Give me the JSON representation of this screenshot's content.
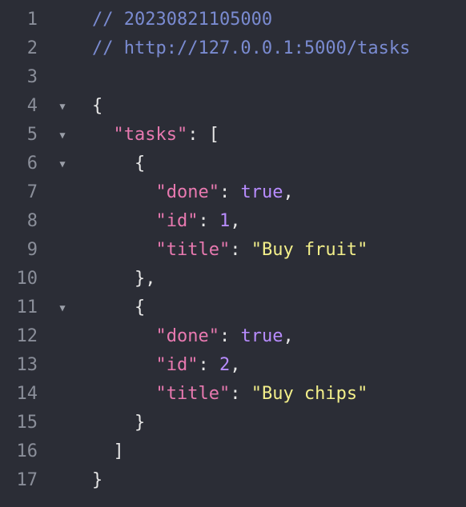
{
  "editor": {
    "lines": [
      {
        "n": "1",
        "fold": false,
        "tokens": [
          {
            "t": "// 20230821105000",
            "c": "comment"
          }
        ]
      },
      {
        "n": "2",
        "fold": false,
        "tokens": [
          {
            "t": "// http://127.0.0.1:5000/tasks",
            "c": "comment"
          }
        ]
      },
      {
        "n": "3",
        "fold": false,
        "tokens": []
      },
      {
        "n": "4",
        "fold": true,
        "tokens": [
          {
            "t": "{",
            "c": "punc"
          }
        ]
      },
      {
        "n": "5",
        "fold": true,
        "tokens": [
          {
            "t": "  ",
            "c": "punc"
          },
          {
            "t": "\"tasks\"",
            "c": "key"
          },
          {
            "t": ": [",
            "c": "punc"
          }
        ]
      },
      {
        "n": "6",
        "fold": true,
        "tokens": [
          {
            "t": "    {",
            "c": "punc"
          }
        ]
      },
      {
        "n": "7",
        "fold": false,
        "tokens": [
          {
            "t": "      ",
            "c": "punc"
          },
          {
            "t": "\"done\"",
            "c": "key"
          },
          {
            "t": ": ",
            "c": "punc"
          },
          {
            "t": "true",
            "c": "bool"
          },
          {
            "t": ",",
            "c": "punc"
          }
        ]
      },
      {
        "n": "8",
        "fold": false,
        "tokens": [
          {
            "t": "      ",
            "c": "punc"
          },
          {
            "t": "\"id\"",
            "c": "key"
          },
          {
            "t": ": ",
            "c": "punc"
          },
          {
            "t": "1",
            "c": "num"
          },
          {
            "t": ",",
            "c": "punc"
          }
        ]
      },
      {
        "n": "9",
        "fold": false,
        "tokens": [
          {
            "t": "      ",
            "c": "punc"
          },
          {
            "t": "\"title\"",
            "c": "key"
          },
          {
            "t": ": ",
            "c": "punc"
          },
          {
            "t": "\"Buy fruit\"",
            "c": "str"
          }
        ]
      },
      {
        "n": "10",
        "fold": false,
        "tokens": [
          {
            "t": "    },",
            "c": "punc"
          }
        ]
      },
      {
        "n": "11",
        "fold": true,
        "tokens": [
          {
            "t": "    {",
            "c": "punc"
          }
        ]
      },
      {
        "n": "12",
        "fold": false,
        "tokens": [
          {
            "t": "      ",
            "c": "punc"
          },
          {
            "t": "\"done\"",
            "c": "key"
          },
          {
            "t": ": ",
            "c": "punc"
          },
          {
            "t": "true",
            "c": "bool"
          },
          {
            "t": ",",
            "c": "punc"
          }
        ]
      },
      {
        "n": "13",
        "fold": false,
        "tokens": [
          {
            "t": "      ",
            "c": "punc"
          },
          {
            "t": "\"id\"",
            "c": "key"
          },
          {
            "t": ": ",
            "c": "punc"
          },
          {
            "t": "2",
            "c": "num"
          },
          {
            "t": ",",
            "c": "punc"
          }
        ]
      },
      {
        "n": "14",
        "fold": false,
        "tokens": [
          {
            "t": "      ",
            "c": "punc"
          },
          {
            "t": "\"title\"",
            "c": "key"
          },
          {
            "t": ": ",
            "c": "punc"
          },
          {
            "t": "\"Buy chips\"",
            "c": "str"
          }
        ]
      },
      {
        "n": "15",
        "fold": false,
        "tokens": [
          {
            "t": "    }",
            "c": "punc"
          }
        ]
      },
      {
        "n": "16",
        "fold": false,
        "tokens": [
          {
            "t": "  ]",
            "c": "punc"
          }
        ]
      },
      {
        "n": "17",
        "fold": false,
        "tokens": [
          {
            "t": "}",
            "c": "punc"
          }
        ]
      }
    ],
    "fold_icon": "triangle-down-icon",
    "colors": {
      "background": "#2b2d36",
      "line_number": "#8a8e99",
      "comment": "#7a8bd1",
      "key": "#e879b0",
      "literal": "#b88cff",
      "string": "#f3ef8a",
      "punctuation": "#e6e6e6"
    }
  }
}
